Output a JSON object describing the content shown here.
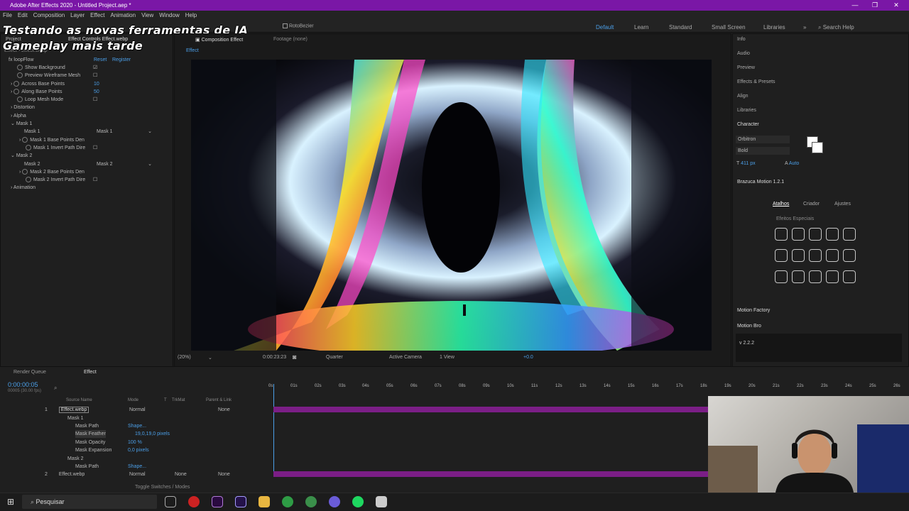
{
  "window": {
    "title": "Adobe After Effects 2020 - Untitled Project.aep *",
    "controls": [
      "—",
      "❐",
      "✕"
    ]
  },
  "menu": [
    "File",
    "Edit",
    "Composition",
    "Layer",
    "Effect",
    "Animation",
    "View",
    "Window",
    "Help"
  ],
  "overlay": {
    "line1": "Testando as novas ferramentas de IA",
    "line2": "Gameplay mais tarde"
  },
  "toolbar": {
    "rotobezier": "RotoBezier"
  },
  "workspaces": {
    "items": [
      "Default",
      "Learn",
      "Standard",
      "Small Screen",
      "Libraries"
    ],
    "more": "»",
    "search": "Search Help"
  },
  "effect_controls": {
    "tab": "Effect Controls Effect.webp",
    "project_tab": "Project",
    "header": "Effect • Effect.webp",
    "effect_name": "loopFlow",
    "reset": "Reset",
    "register": "Register",
    "rows": [
      {
        "label": "Show Background",
        "value": "☑"
      },
      {
        "label": "Preview Wireframe Mesh",
        "value": "☐"
      },
      {
        "label": "Across Base Points",
        "value": "10"
      },
      {
        "label": "Along Base Points",
        "value": "50"
      },
      {
        "label": "Loop Mesh Mode",
        "value": "☐"
      },
      {
        "label": "Distortion",
        "value": ""
      },
      {
        "label": "Alpha",
        "value": ""
      },
      {
        "label": "Mask 1",
        "value": ""
      },
      {
        "label": "Mask 1",
        "value": "Mask 1"
      },
      {
        "label": "Mask 1 Base Points Den",
        "value": ""
      },
      {
        "label": "Mask 1 Invert Path Dire",
        "value": "☐"
      },
      {
        "label": "Mask 2",
        "value": ""
      },
      {
        "label": "Mask 2",
        "value": "Mask 2"
      },
      {
        "label": "Mask 2 Base Points Den",
        "value": ""
      },
      {
        "label": "Mask 2 Invert Path Dire",
        "value": "☐"
      },
      {
        "label": "Animation",
        "value": ""
      }
    ]
  },
  "composition": {
    "tab": "Composition Effect",
    "footage": "Footage (none)",
    "subtab": "Effect",
    "zoom": "(20%)",
    "timecode": "0:00:23:23",
    "resolution": "Quarter",
    "camera": "Active Camera",
    "view": "1 View",
    "offset": "+0.0"
  },
  "right_panel": {
    "items": [
      "Info",
      "Audio",
      "Preview",
      "Effects & Presets",
      "Align",
      "Libraries"
    ],
    "character": {
      "title": "Character",
      "font": "Orbitron",
      "style": "Bold",
      "size": "411 px",
      "leading": "Auto"
    },
    "brazuca": {
      "title": "Brazuca Motion 1.2.1",
      "tabs": [
        "Atalhos",
        "Criador",
        "Ajustes"
      ],
      "section": "Efeitos Especiais"
    },
    "motion_factory": "Motion Factory",
    "motion_bro": "Motion Bro",
    "version": "v 2.2.2"
  },
  "timeline": {
    "tabs": [
      "Render Queue",
      "Effect"
    ],
    "timecode": "0:00:00:05",
    "fps": "00005 (30.00 fps)",
    "columns": [
      "Source Name",
      "Mode",
      "T",
      "TrkMat",
      "Parent & Link"
    ],
    "ruler": [
      "0s",
      "01s",
      "02s",
      "03s",
      "04s",
      "05s",
      "06s",
      "07s",
      "08s",
      "09s",
      "10s",
      "11s",
      "12s",
      "13s",
      "14s",
      "15s",
      "16s",
      "17s",
      "18s",
      "19s",
      "20s",
      "21s",
      "22s",
      "23s",
      "24s",
      "25s",
      "26s"
    ],
    "layers": [
      {
        "num": "1",
        "name": "Effect.webp",
        "mode": "Normal",
        "trkmat": "",
        "parent": "None"
      },
      {
        "name": "Mask 1"
      },
      {
        "name": "Mask Path",
        "value": "Shape..."
      },
      {
        "name": "Mask Feather",
        "value": "19,0,19,0 pixels"
      },
      {
        "name": "Mask Opacity",
        "value": "100 %"
      },
      {
        "name": "Mask Expansion",
        "value": "0,0 pixels"
      },
      {
        "name": "Mask 2"
      },
      {
        "name": "Mask Path",
        "value": "Shape..."
      },
      {
        "num": "2",
        "name": "Effect.webp",
        "mode": "Normal",
        "trkmat": "None",
        "parent": "None"
      }
    ],
    "toggle": "Toggle Switches / Modes"
  },
  "taskbar": {
    "search": "Pesquisar"
  }
}
